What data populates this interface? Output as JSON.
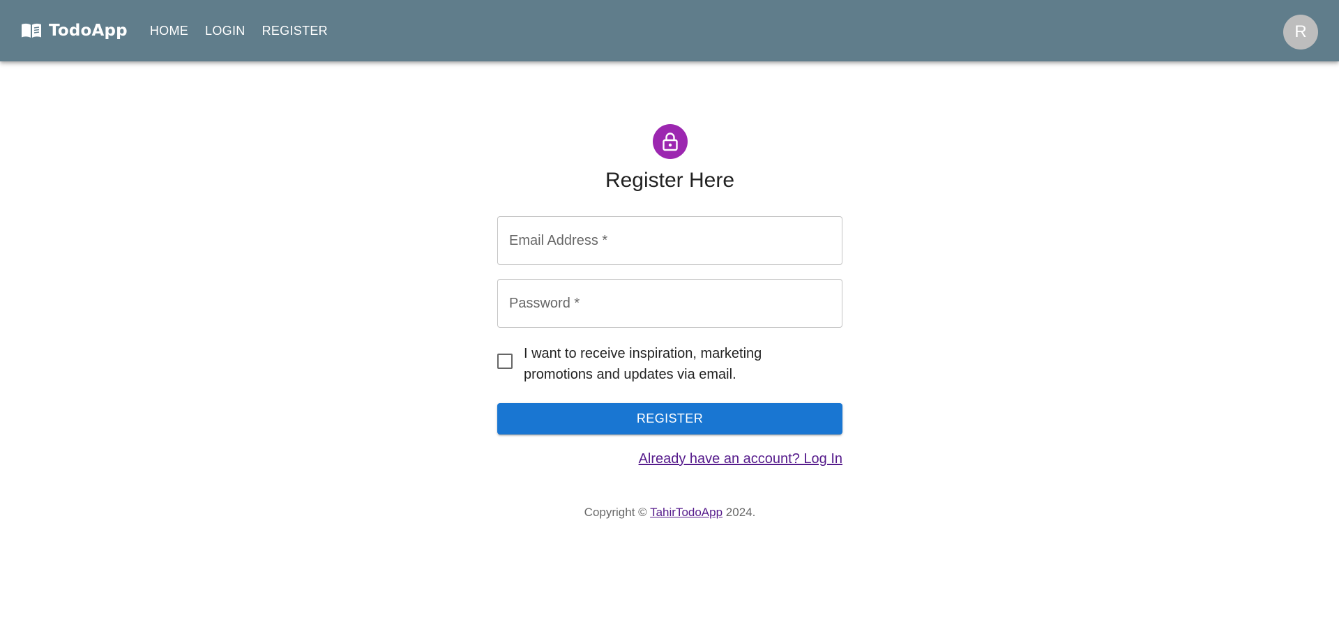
{
  "header": {
    "brand": "TodoApp",
    "brand_icon": "book-open-icon",
    "nav": [
      {
        "label": "HOME"
      },
      {
        "label": "LOGIN"
      },
      {
        "label": "REGISTER"
      }
    ],
    "avatar_initial": "R"
  },
  "form": {
    "lock_icon": "lock-icon",
    "title": "Register Here",
    "email": {
      "label": "Email Address *",
      "value": ""
    },
    "password": {
      "label": "Password *",
      "value": ""
    },
    "marketing_checkbox": {
      "checked": false,
      "label": "I want to receive inspiration, marketing promotions and updates via email."
    },
    "submit_label": "REGISTER",
    "login_link": "Already have an account? Log In"
  },
  "footer": {
    "prefix": "Copyright © ",
    "link": "TahirTodoApp",
    "suffix": " 2024."
  },
  "colors": {
    "appbar": "#607d8b",
    "lock_avatar": "#9c27b0",
    "primary": "#1976d2",
    "link": "#551a8b"
  }
}
